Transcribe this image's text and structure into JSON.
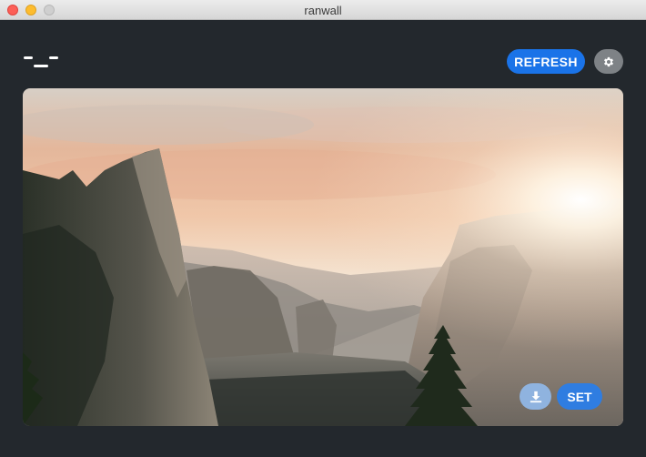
{
  "window": {
    "title": "ranwall"
  },
  "header": {
    "logo_icon": "ranwall-logo-icon",
    "refresh_label": "REFRESH",
    "settings_icon": "gear-icon"
  },
  "wallpaper": {
    "description_icon": "mountain-valley-sunrise-image"
  },
  "actions": {
    "download_icon": "download-icon",
    "set_label": "SET"
  },
  "colors": {
    "background": "#23282d",
    "accent": "#1a73e8",
    "settings_button": "#7e8286",
    "download_button": "#8fb3df",
    "set_button": "#2f7de1"
  }
}
